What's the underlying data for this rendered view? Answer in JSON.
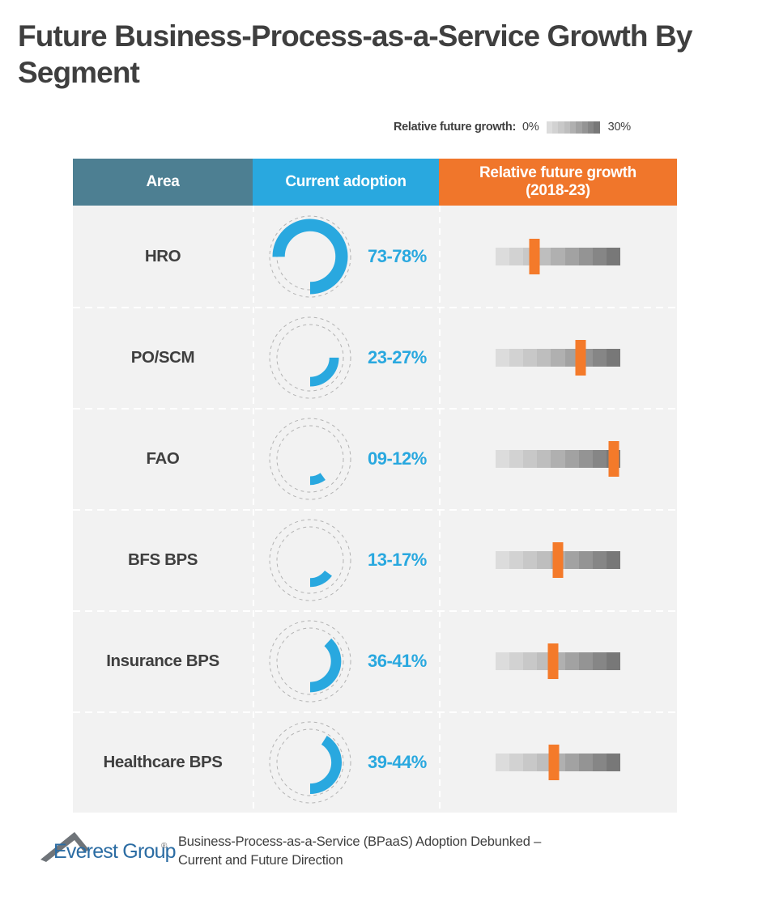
{
  "title": "Future Business-Process-as-a-Service Growth By Segment",
  "legend": {
    "label": "Relative future growth:",
    "min": "0%",
    "max": "30%",
    "gradient_colors": [
      "#dcdcdc",
      "#d2d2d2",
      "#c8c8c8",
      "#bebebe",
      "#b0b0b0",
      "#a2a2a2",
      "#949494",
      "#868686",
      "#787878"
    ]
  },
  "table": {
    "headers": {
      "area": "Area",
      "adoption": "Current adoption",
      "growth": "Relative future growth (2018-23)",
      "growth_line1": "Relative future growth",
      "growth_line2": "(2018-23)"
    },
    "header_colors": {
      "area": "#4d7f92",
      "adoption": "#29a8df",
      "growth": "#f0762b"
    },
    "rows": [
      {
        "area": "HRO",
        "adoption_label": "73-78%",
        "adoption_low": 73,
        "adoption_high": 78,
        "adoption_pct": 75,
        "growth_marker_pct": 31
      },
      {
        "area": "PO/SCM",
        "adoption_label": "23-27%",
        "adoption_low": 23,
        "adoption_high": 27,
        "adoption_pct": 25,
        "growth_marker_pct": 68
      },
      {
        "area": "FAO",
        "adoption_label": "09-12%",
        "adoption_low": 9,
        "adoption_high": 12,
        "adoption_pct": 10,
        "growth_marker_pct": 95
      },
      {
        "area": "BFS BPS",
        "adoption_label": "13-17%",
        "adoption_low": 13,
        "adoption_high": 17,
        "adoption_pct": 15,
        "growth_marker_pct": 50
      },
      {
        "area": "Insurance BPS",
        "adoption_label": "36-41%",
        "adoption_low": 36,
        "adoption_high": 41,
        "adoption_pct": 38,
        "growth_marker_pct": 46
      },
      {
        "area": "Healthcare BPS",
        "adoption_label": "39-44%",
        "adoption_low": 39,
        "adoption_high": 44,
        "adoption_pct": 41,
        "growth_marker_pct": 47
      }
    ]
  },
  "footer": {
    "logo_text": "Everest Group",
    "logo_registered": "®",
    "caption_line1": "Business-Process-as-a-Service (BPaaS) Adoption Debunked –",
    "caption_line2": "Current and Future Direction",
    "caption": "Business-Process-as-a-Service (BPaaS) Adoption Debunked – Current and Future Direction"
  },
  "colors": {
    "accent_blue": "#29a8df",
    "accent_orange": "#f0762b",
    "marker_orange": "#f47a2a",
    "header_slate": "#4d7f92",
    "text_dark": "#3f3f3f",
    "row_bg": "#f2f2f2"
  },
  "chart_data": {
    "type": "table",
    "title": "Future Business-Process-as-a-Service Growth By Segment",
    "categories": [
      "HRO",
      "PO/SCM",
      "FAO",
      "BFS BPS",
      "Insurance BPS",
      "Healthcare BPS"
    ],
    "series": [
      {
        "name": "Current adoption",
        "unit": "%",
        "labels": [
          "73-78%",
          "23-27%",
          "09-12%",
          "13-17%",
          "36-41%",
          "39-44%"
        ],
        "low": [
          73,
          23,
          9,
          13,
          36,
          39
        ],
        "high": [
          78,
          27,
          12,
          17,
          41,
          44
        ],
        "values": [
          75,
          25,
          10,
          15,
          38,
          41
        ]
      },
      {
        "name": "Relative future growth (2018-23)",
        "unit": "% of 0-30% scale",
        "scale_min": 0,
        "scale_max": 30,
        "marker_positions_pct": [
          31,
          68,
          95,
          50,
          46,
          47
        ],
        "values": [
          9.3,
          20.4,
          28.5,
          15.0,
          13.8,
          14.1
        ]
      }
    ],
    "legend": {
      "label": "Relative future growth:",
      "min": "0%",
      "max": "30%",
      "position": "top-right"
    },
    "grid": false
  }
}
